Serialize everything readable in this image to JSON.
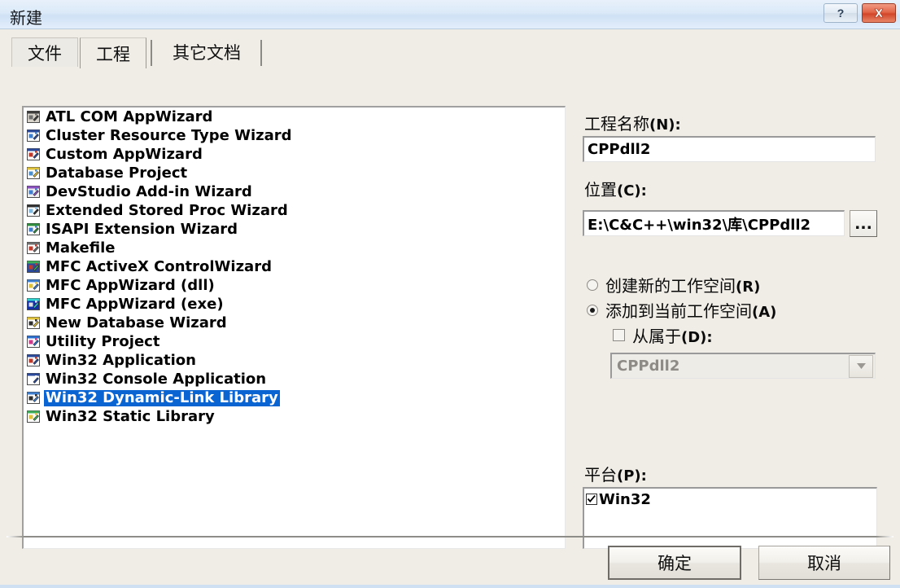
{
  "window": {
    "title": "新建",
    "help_button": "?",
    "close_button": "✕"
  },
  "tabs": [
    {
      "label": "文件",
      "active": false
    },
    {
      "label": "工程",
      "active": true
    },
    {
      "label": "其它文档",
      "active": false
    }
  ],
  "project_list": {
    "items": [
      {
        "label": "ATL COM AppWizard",
        "selected": false,
        "icon": "atl-com-appwizard-icon"
      },
      {
        "label": "Cluster Resource Type Wizard",
        "selected": false,
        "icon": "cluster-resource-wizard-icon"
      },
      {
        "label": "Custom AppWizard",
        "selected": false,
        "icon": "custom-appwizard-icon"
      },
      {
        "label": "Database Project",
        "selected": false,
        "icon": "database-project-icon"
      },
      {
        "label": "DevStudio Add-in Wizard",
        "selected": false,
        "icon": "devstudio-addin-icon"
      },
      {
        "label": "Extended Stored Proc Wizard",
        "selected": false,
        "icon": "extended-stored-proc-icon"
      },
      {
        "label": "ISAPI Extension Wizard",
        "selected": false,
        "icon": "isapi-extension-icon"
      },
      {
        "label": "Makefile",
        "selected": false,
        "icon": "makefile-icon"
      },
      {
        "label": "MFC ActiveX ControlWizard",
        "selected": false,
        "icon": "mfc-activex-icon"
      },
      {
        "label": "MFC AppWizard (dll)",
        "selected": false,
        "icon": "mfc-appwizard-dll-icon"
      },
      {
        "label": "MFC AppWizard (exe)",
        "selected": false,
        "icon": "mfc-appwizard-exe-icon"
      },
      {
        "label": "New Database Wizard",
        "selected": false,
        "icon": "new-database-wizard-icon"
      },
      {
        "label": "Utility Project",
        "selected": false,
        "icon": "utility-project-icon"
      },
      {
        "label": "Win32 Application",
        "selected": false,
        "icon": "win32-application-icon"
      },
      {
        "label": "Win32 Console Application",
        "selected": false,
        "icon": "win32-console-icon"
      },
      {
        "label": "Win32 Dynamic-Link Library",
        "selected": true,
        "icon": "win32-dll-icon"
      },
      {
        "label": "Win32 Static Library",
        "selected": false,
        "icon": "win32-static-lib-icon"
      }
    ],
    "selection_color": "#0a64d2"
  },
  "project_name": {
    "label": "工程名称",
    "mnemonic": "(N):",
    "value": "CPPdll2"
  },
  "location": {
    "label": "位置",
    "mnemonic": "(C):",
    "value": "E:\\C&C++\\win32\\库\\CPPdll2",
    "browse_label": "..."
  },
  "workspace": {
    "create_new": {
      "label": "创建新的工作空间",
      "mnemonic": "(R)",
      "selected": false
    },
    "add_current": {
      "label": "添加到当前工作空间",
      "mnemonic": "(A)",
      "selected": true
    },
    "dependency_check": {
      "label": "从属于",
      "mnemonic": "(D):",
      "checked": false
    },
    "dependency_combo": {
      "value": "CPPdll2",
      "enabled": false,
      "arrow": "▼"
    }
  },
  "platform": {
    "label": "平台",
    "mnemonic": "(P):",
    "items": [
      {
        "label": "Win32",
        "checked": true
      }
    ]
  },
  "buttons": {
    "ok": "确定",
    "cancel": "取消"
  }
}
